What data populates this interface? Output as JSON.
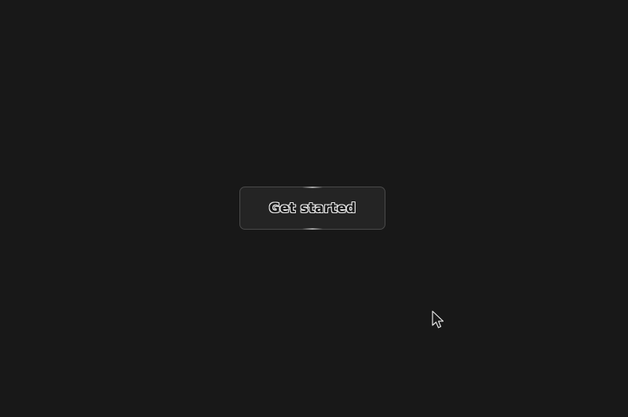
{
  "page": {
    "background_color": "#181818"
  },
  "cta": {
    "label": "Get started",
    "background_color": "#242424",
    "border_color": "#4a4a4a"
  },
  "cursor": {
    "icon": "arrow-pointer-icon"
  }
}
